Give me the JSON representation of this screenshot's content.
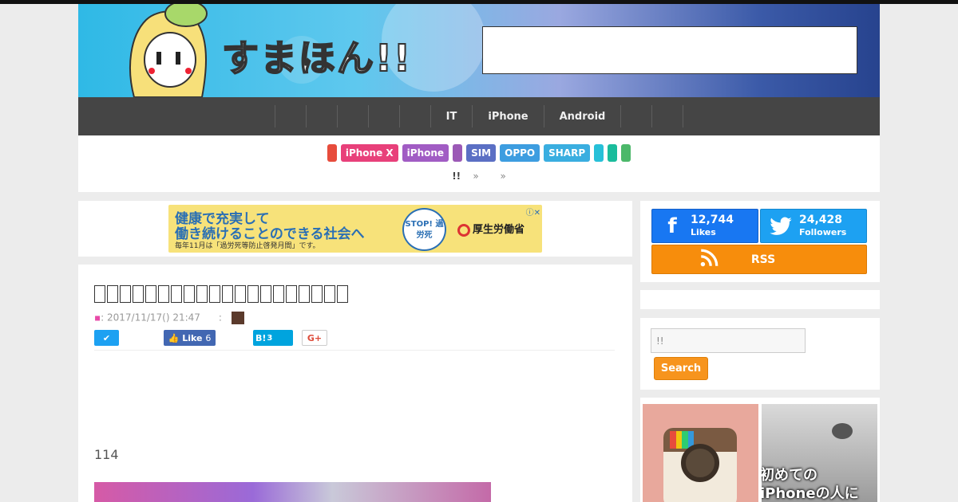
{
  "site": {
    "logo_text": "すまほん!!"
  },
  "nav": {
    "items": [
      "",
      "",
      "",
      "",
      "",
      "IT",
      "iPhone",
      "Android",
      "",
      ""
    ]
  },
  "tags": [
    {
      "label": "",
      "color": "#e74c3c"
    },
    {
      "label": "iPhone X",
      "color": "#e8407a"
    },
    {
      "label": "iPhone",
      "color": "#a15cc4"
    },
    {
      "label": "",
      "color": "#9b59b6"
    },
    {
      "label": "SIM",
      "color": "#5b6fc4"
    },
    {
      "label": "OPPO",
      "color": "#3d9de0"
    },
    {
      "label": "SHARP",
      "color": "#3aaee0"
    },
    {
      "label": "",
      "color": "#27c0d8"
    },
    {
      "label": "",
      "color": "#1abc9c"
    },
    {
      "label": "",
      "color": "#4cb86a"
    }
  ],
  "breadcrumb": {
    "home": "!!",
    "sep1": "»",
    "sep2": "»"
  },
  "ad": {
    "line1": "健康で充実して",
    "line2": "働き続けることのできる社会へ",
    "line3": "毎年11月は「過労死等防止啓発月間」です。",
    "stop": "STOP! 過労死",
    "ministry": "厚生労働省",
    "adchoices": "ⓘ✕"
  },
  "article": {
    "title_boxes": 20,
    "date": ": 2017/11/17() 21:47",
    "author_sep": ":",
    "share": {
      "twitter": "🐦",
      "like_label": "Like",
      "like_count": "6",
      "hatena_label": "B!",
      "hatena_count": "3",
      "gplus": "G+"
    },
    "intro": "114"
  },
  "sidebar": {
    "facebook": {
      "count": "12,744",
      "label": "Likes",
      "icon": "f"
    },
    "twitter": {
      "count": "24,428",
      "label": "Followers",
      "icon": "🐦"
    },
    "rss": {
      "label": "RSS",
      "icon": "rss-icon"
    },
    "search": {
      "placeholder": "!!",
      "button": "Search"
    },
    "card2_caption_line1": "初めての",
    "card2_caption_line2": "iPhoneの人に"
  }
}
